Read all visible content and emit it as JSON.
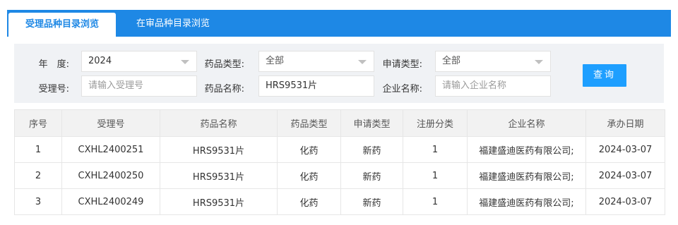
{
  "tabs": [
    {
      "label": "受理品种目录浏览",
      "active": true
    },
    {
      "label": "在审品种目录浏览",
      "active": false
    }
  ],
  "filters": {
    "year_label": "年　度:",
    "year_value": "2024",
    "drug_type_label": "药品类型:",
    "drug_type_value": "全部",
    "apply_type_label": "申请类型:",
    "apply_type_value": "全部",
    "accept_no_label": "受理号:",
    "accept_no_placeholder": "请输入受理号",
    "drug_name_label": "药品名称:",
    "drug_name_value": "HRS9531片",
    "company_label": "企业名称:",
    "company_placeholder": "请输入企业名称",
    "search_button": "查询"
  },
  "table": {
    "headers": [
      "序号",
      "受理号",
      "药品名称",
      "药品类型",
      "申请类型",
      "注册分类",
      "企业名称",
      "承办日期"
    ],
    "rows": [
      [
        "1",
        "CXHL2400251",
        "HRS9531片",
        "化药",
        "新药",
        "1",
        "福建盛迪医药有限公司;",
        "2024-03-07"
      ],
      [
        "2",
        "CXHL2400250",
        "HRS9531片",
        "化药",
        "新药",
        "1",
        "福建盛迪医药有限公司;",
        "2024-03-07"
      ],
      [
        "3",
        "CXHL2400249",
        "HRS9531片",
        "化药",
        "新药",
        "1",
        "福建盛迪医药有限公司;",
        "2024-03-07"
      ]
    ]
  }
}
